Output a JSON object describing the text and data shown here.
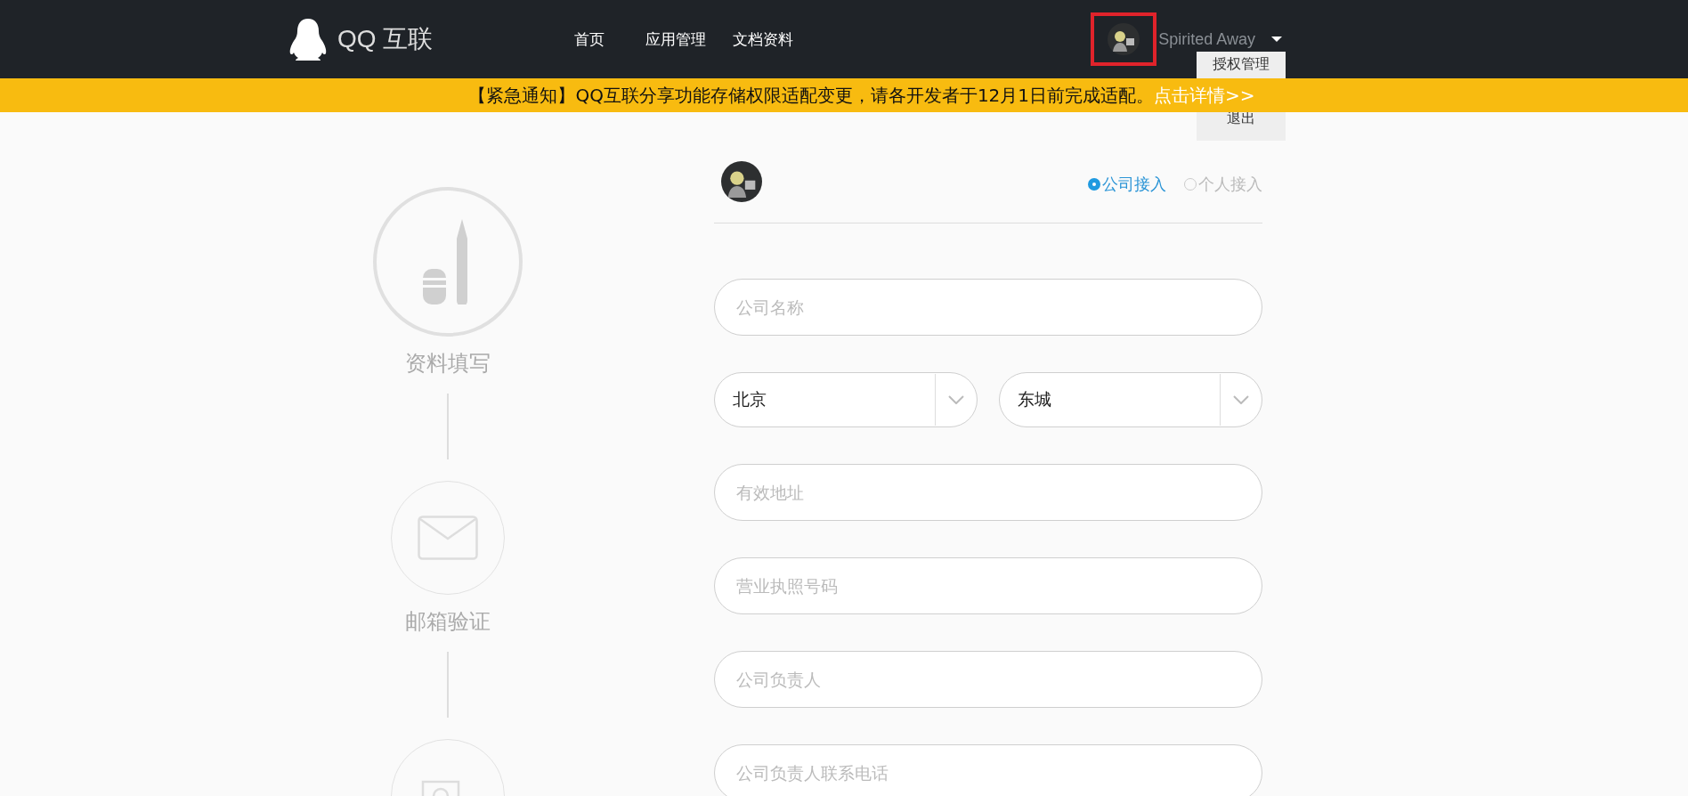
{
  "header": {
    "logo_text": "QQ 互联",
    "nav": [
      {
        "label": "首页"
      },
      {
        "label": "应用管理"
      },
      {
        "label": "文档资料"
      }
    ],
    "user": {
      "name": "Spirited Away",
      "highlighted": true
    },
    "user_menu": {
      "expanded": true,
      "items": [
        {
          "label": "授权管理"
        },
        {
          "label": "退出"
        }
      ]
    }
  },
  "notice": {
    "text": "【紧急通知】QQ互联分享功能存储权限适配变更，请各开发者于12月1日前完成适配。",
    "link": "点击详情>>"
  },
  "steps": [
    {
      "kind": "pen",
      "label": "资料填写",
      "active": true
    },
    {
      "kind": "mail",
      "label": "邮箱验证",
      "active": false
    },
    {
      "kind": "photo",
      "active": false
    }
  ],
  "form": {
    "access_types": [
      {
        "label": "公司接入",
        "selected": true
      },
      {
        "label": "个人接入",
        "selected": false
      }
    ],
    "fields": [
      {
        "kind": "text",
        "placeholder": "公司名称"
      },
      {
        "kind": "selects",
        "values": [
          "北京",
          "东城"
        ]
      },
      {
        "kind": "text",
        "placeholder": "有效地址"
      },
      {
        "kind": "text",
        "placeholder": "营业执照号码"
      },
      {
        "kind": "text",
        "placeholder": "公司负责人"
      },
      {
        "kind": "text",
        "placeholder": "公司负责人联系电话"
      }
    ]
  }
}
